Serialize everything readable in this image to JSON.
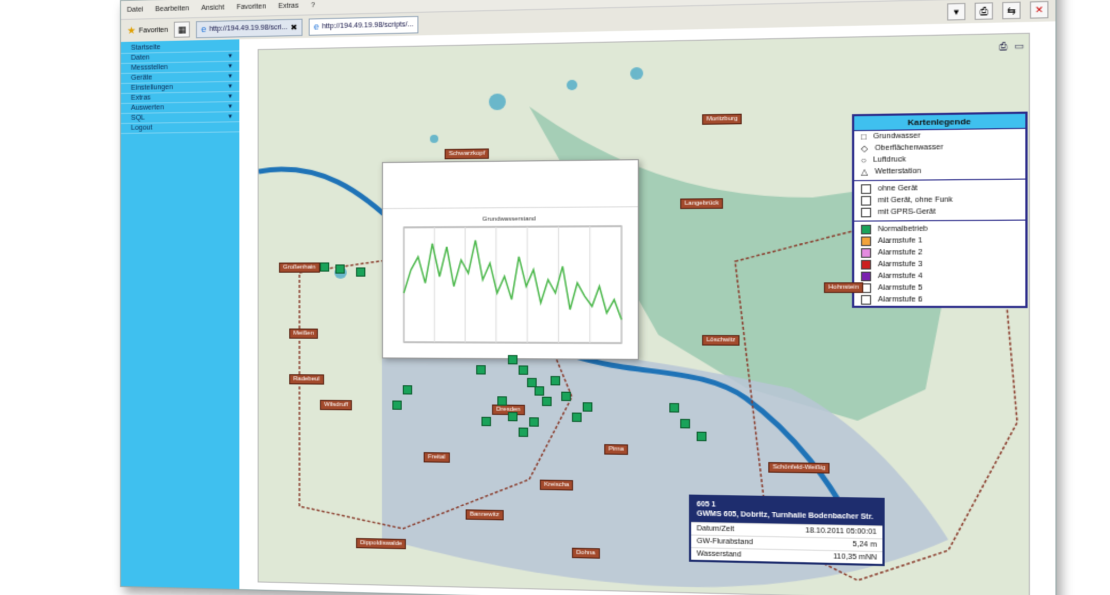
{
  "menu": [
    "Datei",
    "Bearbeiten",
    "Ansicht",
    "Favoriten",
    "Extras",
    "?"
  ],
  "toolbar": {
    "favorites_label": "Favoriten",
    "tabs": [
      {
        "label": "http://194.49.19.98/scri..."
      },
      {
        "label": "http://194.49.19.98/scripts/..."
      }
    ]
  },
  "sidebar": {
    "items": [
      {
        "label": "Startseite",
        "has_arrow": false
      },
      {
        "label": "Daten",
        "has_arrow": true
      },
      {
        "label": "Messstellen",
        "has_arrow": true
      },
      {
        "label": "Geräte",
        "has_arrow": true
      },
      {
        "label": "Einstellungen",
        "has_arrow": true
      },
      {
        "label": "Extras",
        "has_arrow": true
      },
      {
        "label": "Auswerten",
        "has_arrow": true
      },
      {
        "label": "SQL",
        "has_arrow": true
      },
      {
        "label": "Logout",
        "has_arrow": false
      }
    ]
  },
  "legend": {
    "title": "Kartenlegende",
    "types": [
      "Grundwasser",
      "Oberflächenwasser",
      "Luftdruck",
      "Wetterstation"
    ],
    "devices": [
      "ohne Gerät",
      "mit Gerät, ohne Funk",
      "mit GPRS-Gerät"
    ],
    "status": [
      {
        "label": "Normalbetrieb",
        "color": "#1aa35a"
      },
      {
        "label": "Alarmstufe 1",
        "color": "#f2a33a"
      },
      {
        "label": "Alarmstufe 2",
        "color": "#e38adf"
      },
      {
        "label": "Alarmstufe 3",
        "color": "#cc1f1f"
      },
      {
        "label": "Alarmstufe 4",
        "color": "#7a1fb0"
      },
      {
        "label": "Alarmstufe 5",
        "color": "#ffffff"
      },
      {
        "label": "Alarmstufe 6",
        "color": "#ffffff"
      }
    ]
  },
  "places": [
    "Großenhain",
    "Schwarzkopf",
    "Langebrück",
    "Moritzburg",
    "Meißen",
    "Radebeul",
    "Wilsdruff",
    "Freital",
    "Dresden",
    "Pirna",
    "Bannewitz",
    "Dohna",
    "Löschwitz",
    "Schönfeld-Weißig",
    "Hohnstein",
    "Dippoldiswalde",
    "Kreischa"
  ],
  "info": {
    "id": "605 1",
    "title": "GWMS 605, Dobritz, Turnhalle Bodenbacher Str.",
    "rows": [
      {
        "label": "Datum/Zeit",
        "value": "18.10.2011 05:00:01"
      },
      {
        "label": "GW-Flurabstand",
        "value": "5,24 m"
      },
      {
        "label": "Wasserstand",
        "value": "110,35 mNN"
      }
    ]
  },
  "chart_title": "Grundwasserstand",
  "chart_series": [
    30,
    44,
    52,
    36,
    60,
    40,
    58,
    34,
    50,
    42,
    62,
    38,
    48,
    30,
    40,
    26,
    52,
    34,
    44,
    24,
    38,
    30,
    46,
    20,
    36,
    28,
    22,
    34,
    18,
    26,
    14
  ]
}
